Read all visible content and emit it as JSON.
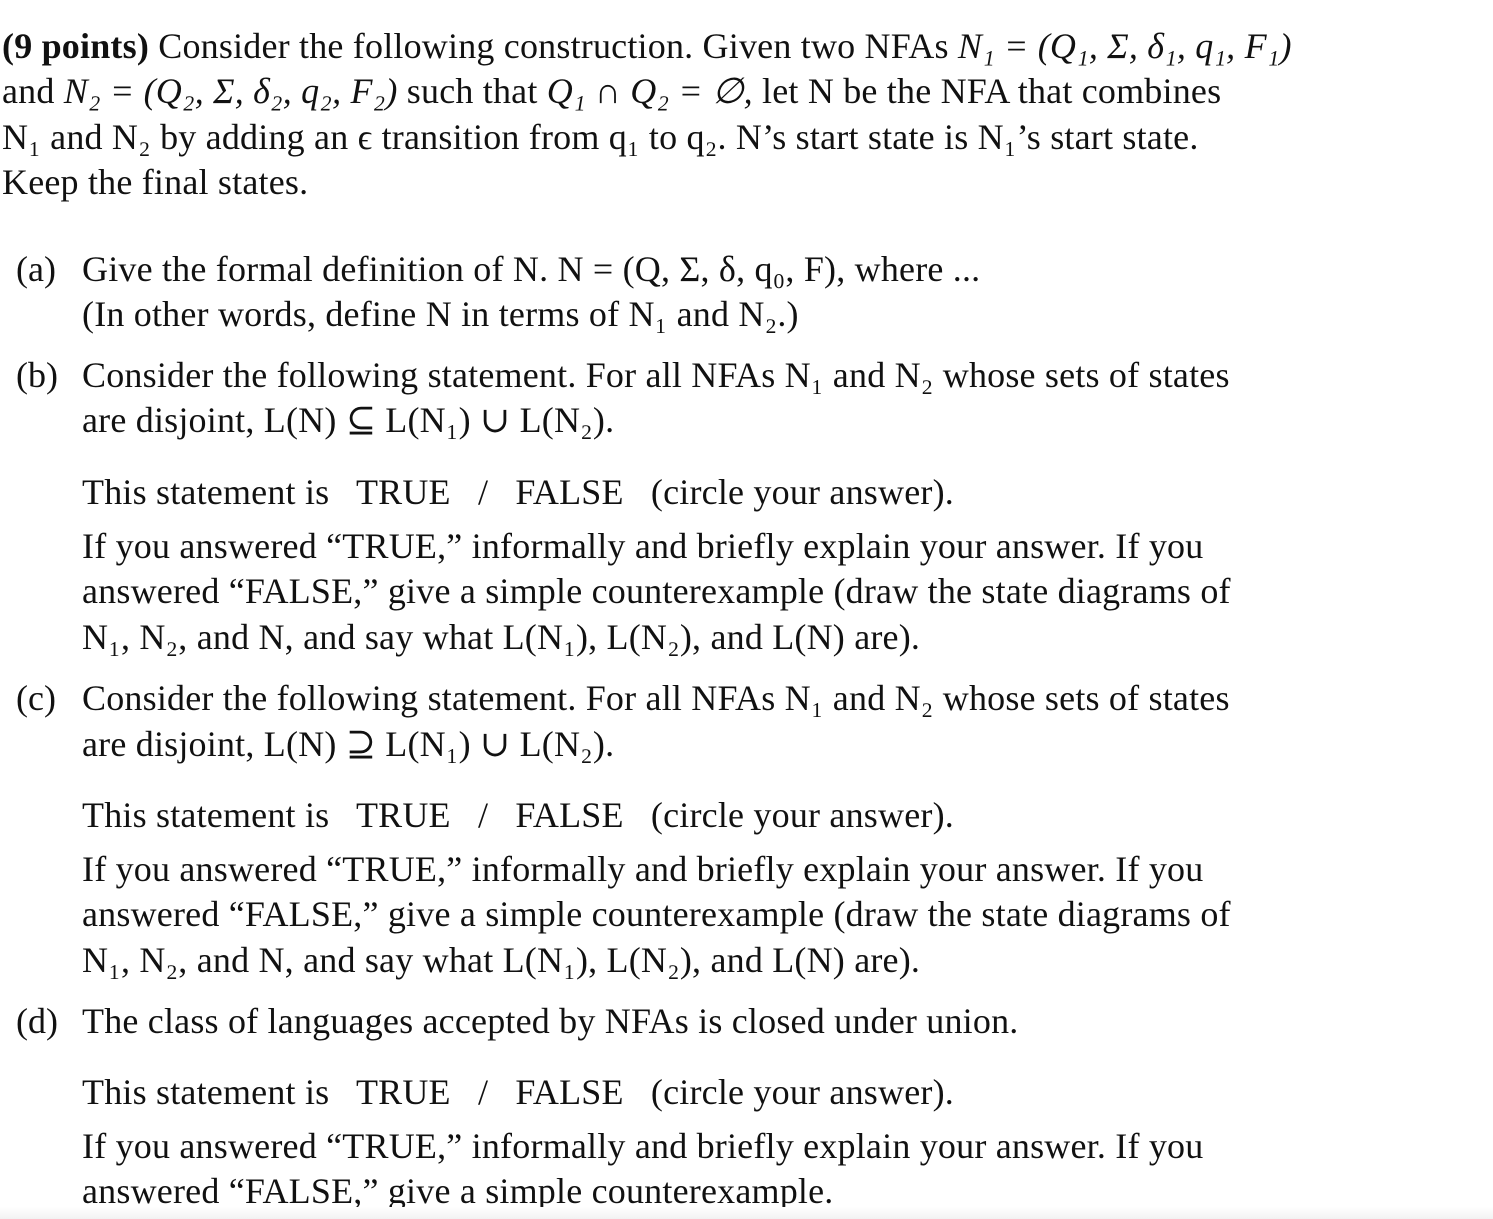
{
  "intro": {
    "points": "(9 points)",
    "line1_text": "Consider the following construction. Given two NFAs",
    "line1_math": "N₁ = (Q₁, Σ, δ₁, q₁, F₁)",
    "line2_pre": "and",
    "line2_math": "N₂ = (Q₂, Σ, δ₂, q₂, F₂)",
    "line2_mid": "such that",
    "line2_math2": "Q₁ ∩ Q₂ = ∅,",
    "line2_post": "let N be the NFA that combines",
    "line3": "N₁ and N₂ by adding an ϵ transition from q₁ to q₂. N’s start state is N₁’s start state.",
    "line4": "Keep the final states."
  },
  "parts": [
    {
      "label": "(a)",
      "lines": [
        "Give the formal definition of N. N = (Q, Σ, δ, q₀, F), where ...",
        "(In other words, define N in terms of N₁ and N₂.)"
      ]
    },
    {
      "label": "(b)",
      "lines": [
        "Consider the following statement. For all NFAs N₁ and N₂ whose sets of states",
        "are disjoint, L(N) ⊆ L(N₁) ∪ L(N₂)."
      ],
      "answer_prompt": {
        "prefix": "This statement is",
        "option_true": "TRUE",
        "separator": "/",
        "option_false": "FALSE",
        "suffix": "(circle your answer)."
      },
      "instructions": [
        "If you answered “TRUE,” informally and briefly explain your answer. If you",
        "answered “FALSE,” give a simple counterexample (draw the state diagrams of",
        "N₁, N₂, and N, and say what L(N₁), L(N₂), and L(N) are)."
      ]
    },
    {
      "label": "(c)",
      "lines": [
        "Consider the following statement. For all NFAs N₁ and N₂ whose sets of states",
        "are disjoint, L(N) ⊇ L(N₁) ∪ L(N₂)."
      ],
      "answer_prompt": {
        "prefix": "This statement is",
        "option_true": "TRUE",
        "separator": "/",
        "option_false": "FALSE",
        "suffix": "(circle your answer)."
      },
      "instructions": [
        "If you answered “TRUE,” informally and briefly explain your answer. If you",
        "answered “FALSE,” give a simple counterexample (draw the state diagrams of",
        "N₁, N₂, and N, and say what L(N₁), L(N₂), and L(N) are)."
      ]
    },
    {
      "label": "(d)",
      "lines": [
        "The class of languages accepted by NFAs is closed under union."
      ],
      "answer_prompt": {
        "prefix": "This statement is",
        "option_true": "TRUE",
        "separator": "/",
        "option_false": "FALSE",
        "suffix": "(circle your answer)."
      },
      "instructions": [
        "If you answered “TRUE,” informally and briefly explain your answer. If you",
        "answered “FALSE,” give a simple counterexample."
      ]
    }
  ]
}
